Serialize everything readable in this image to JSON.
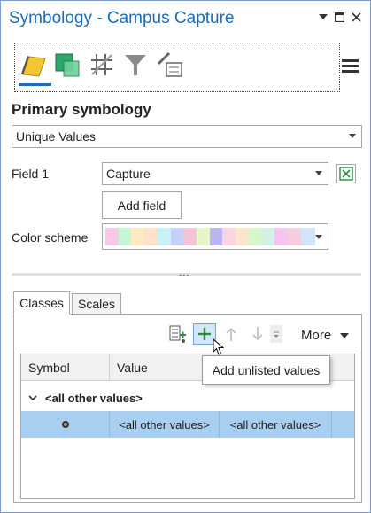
{
  "pane": {
    "title": "Symbology - Campus Capture"
  },
  "window_controls": {
    "dropdown_icon": "chevron-down-icon",
    "maximize_icon": "maximize-icon",
    "close_icon": "close-icon"
  },
  "toolbar": {
    "tools": [
      {
        "icon": "primary-symbology-icon",
        "active": true
      },
      {
        "icon": "vary-symbology-icon",
        "active": false
      },
      {
        "icon": "label-grid-icon",
        "active": false
      },
      {
        "icon": "filter-icon",
        "active": false
      },
      {
        "icon": "symbol-layer-drawing-icon",
        "active": false
      }
    ],
    "menu_icon": "hamburger-menu-icon"
  },
  "primary_symbology": {
    "heading": "Primary symbology",
    "selected": "Unique Values"
  },
  "field1": {
    "label": "Field 1",
    "value": "Capture",
    "expression_icon": "expression-icon",
    "add_field_label": "Add field"
  },
  "color_scheme": {
    "label": "Color scheme",
    "colors": [
      "#f9c8e8",
      "#c9f5d7",
      "#fdeac2",
      "#ffe0c8",
      "#c9f0f7",
      "#c9d0f7",
      "#f3c4d6",
      "#e6f5c8",
      "#b8b5f0",
      "#fbd4df",
      "#fce5cf",
      "#d6f7c9",
      "#d4f0e6",
      "#f4c6ef",
      "#f6cde0",
      "#d3e3fa"
    ]
  },
  "tabs": [
    {
      "label": "Classes",
      "active": true
    },
    {
      "label": "Scales",
      "active": false
    }
  ],
  "classes_toolbar": {
    "add_all_values_icon": "add-all-values-icon",
    "add_unlisted_values_icon": "plus-icon",
    "move_up_icon": "arrow-up-icon",
    "move_down_icon": "arrow-down-icon",
    "more_label": "More"
  },
  "grid": {
    "columns": [
      "Symbol",
      "Value"
    ],
    "group_label": "<all other values>",
    "rows": [
      {
        "value": "<all other values>",
        "label": "<all other values>"
      }
    ]
  },
  "tooltip": {
    "text": "Add unlisted values"
  }
}
